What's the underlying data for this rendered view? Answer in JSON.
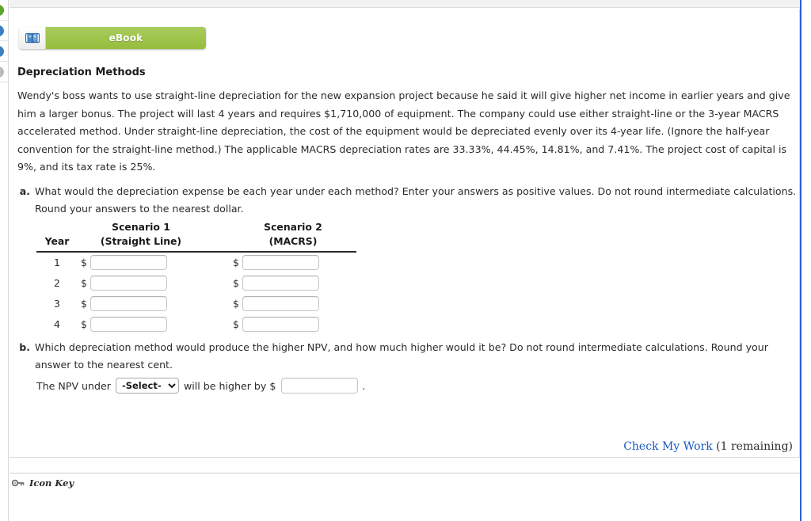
{
  "left_rail": {
    "dots": [
      {
        "name": "rail-dot-green",
        "color": "#5ea32a"
      },
      {
        "name": "rail-dot-blue-1",
        "color": "#3b7fc4"
      },
      {
        "name": "rail-dot-blue-2",
        "color": "#3b7fc4"
      },
      {
        "name": "rail-dot-gray",
        "color": "#bcbcbc"
      }
    ]
  },
  "toolbar": {
    "ebook_label": "eBook",
    "ebook_icon": "open-book-icon",
    "ebook_color": "#9ac34a"
  },
  "page_title": "Depreciation Methods",
  "intro": "Wendy's boss wants to use straight-line depreciation for the new expansion project because he said it will give higher net income in earlier years and give him a larger bonus. The project will last 4 years and requires $1,710,000 of equipment. The company could use either straight-line or the 3-year MACRS accelerated method. Under straight-line depreciation, the cost of the equipment would be depreciated evenly over its 4-year life. (Ignore the half-year convention for the straight-line method.) The applicable MACRS depreciation rates are 33.33%, 44.45%, 14.81%, and 7.41%. The project cost of capital is 9%, and its tax rate is 25%.",
  "parts": {
    "a": {
      "label": "a.",
      "text": "What would the depreciation expense be each year under each method? Enter your answers as positive values. Do not round intermediate calculations. Round your answers to the nearest dollar."
    },
    "b": {
      "label": "b.",
      "text": "Which depreciation method would produce the higher NPV, and how much higher would it be? Do not round intermediate calculations. Round your answer to the nearest cent."
    }
  },
  "table": {
    "headers": {
      "year": "Year",
      "scenario1_top": "Scenario 1",
      "scenario1_sub": "(Straight Line)",
      "scenario2_top": "Scenario 2",
      "scenario2_sub": "(MACRS)"
    },
    "currency_symbol": "$",
    "rows": [
      {
        "year": "1",
        "straight_line": "",
        "macrs": ""
      },
      {
        "year": "2",
        "straight_line": "",
        "macrs": ""
      },
      {
        "year": "3",
        "straight_line": "",
        "macrs": ""
      },
      {
        "year": "4",
        "straight_line": "",
        "macrs": ""
      }
    ]
  },
  "npv_line": {
    "prefix": "The NPV under",
    "select_value": "-Select-",
    "select_options": [
      "-Select-"
    ],
    "middle": "will be higher by $",
    "amount_value": "",
    "suffix": "."
  },
  "check_my_work": {
    "link_text": "Check My Work",
    "remaining_text": " (1 remaining)"
  },
  "icon_key": {
    "label": "Icon Key",
    "icon": "key-icon"
  }
}
